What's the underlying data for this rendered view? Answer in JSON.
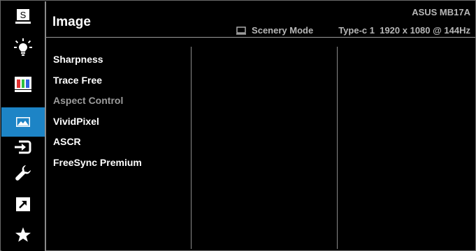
{
  "header": {
    "title": "Image",
    "model": "ASUS MB17A",
    "mode_icon": "monitor-icon",
    "mode": "Scenery Mode",
    "input": "Type-c 1",
    "resolution": "1920 x 1080 @ 144Hz"
  },
  "sidebar": {
    "items": [
      {
        "icon": "splendid-icon",
        "active": false
      },
      {
        "icon": "blue-light-filter-icon",
        "active": false
      },
      {
        "icon": "color-icon",
        "active": false
      },
      {
        "icon": "image-icon",
        "active": true
      },
      {
        "icon": "input-select-icon",
        "active": false
      },
      {
        "icon": "system-setup-icon",
        "active": false
      },
      {
        "icon": "shortcut-icon",
        "active": false
      },
      {
        "icon": "myfavorite-icon",
        "active": false
      }
    ],
    "splendid_letter": "S"
  },
  "menu": {
    "items": [
      {
        "label": "Sharpness",
        "enabled": true
      },
      {
        "label": "Trace Free",
        "enabled": true
      },
      {
        "label": "Aspect Control",
        "enabled": false
      },
      {
        "label": "VividPixel",
        "enabled": true
      },
      {
        "label": "ASCR",
        "enabled": true
      },
      {
        "label": "FreeSync Premium",
        "enabled": true
      }
    ]
  },
  "colors": {
    "accent": "#1d84c6",
    "background": "#000000",
    "text": "#ffffff",
    "disabled_text": "#9c9c9c",
    "status_text": "#b7b7b7"
  }
}
